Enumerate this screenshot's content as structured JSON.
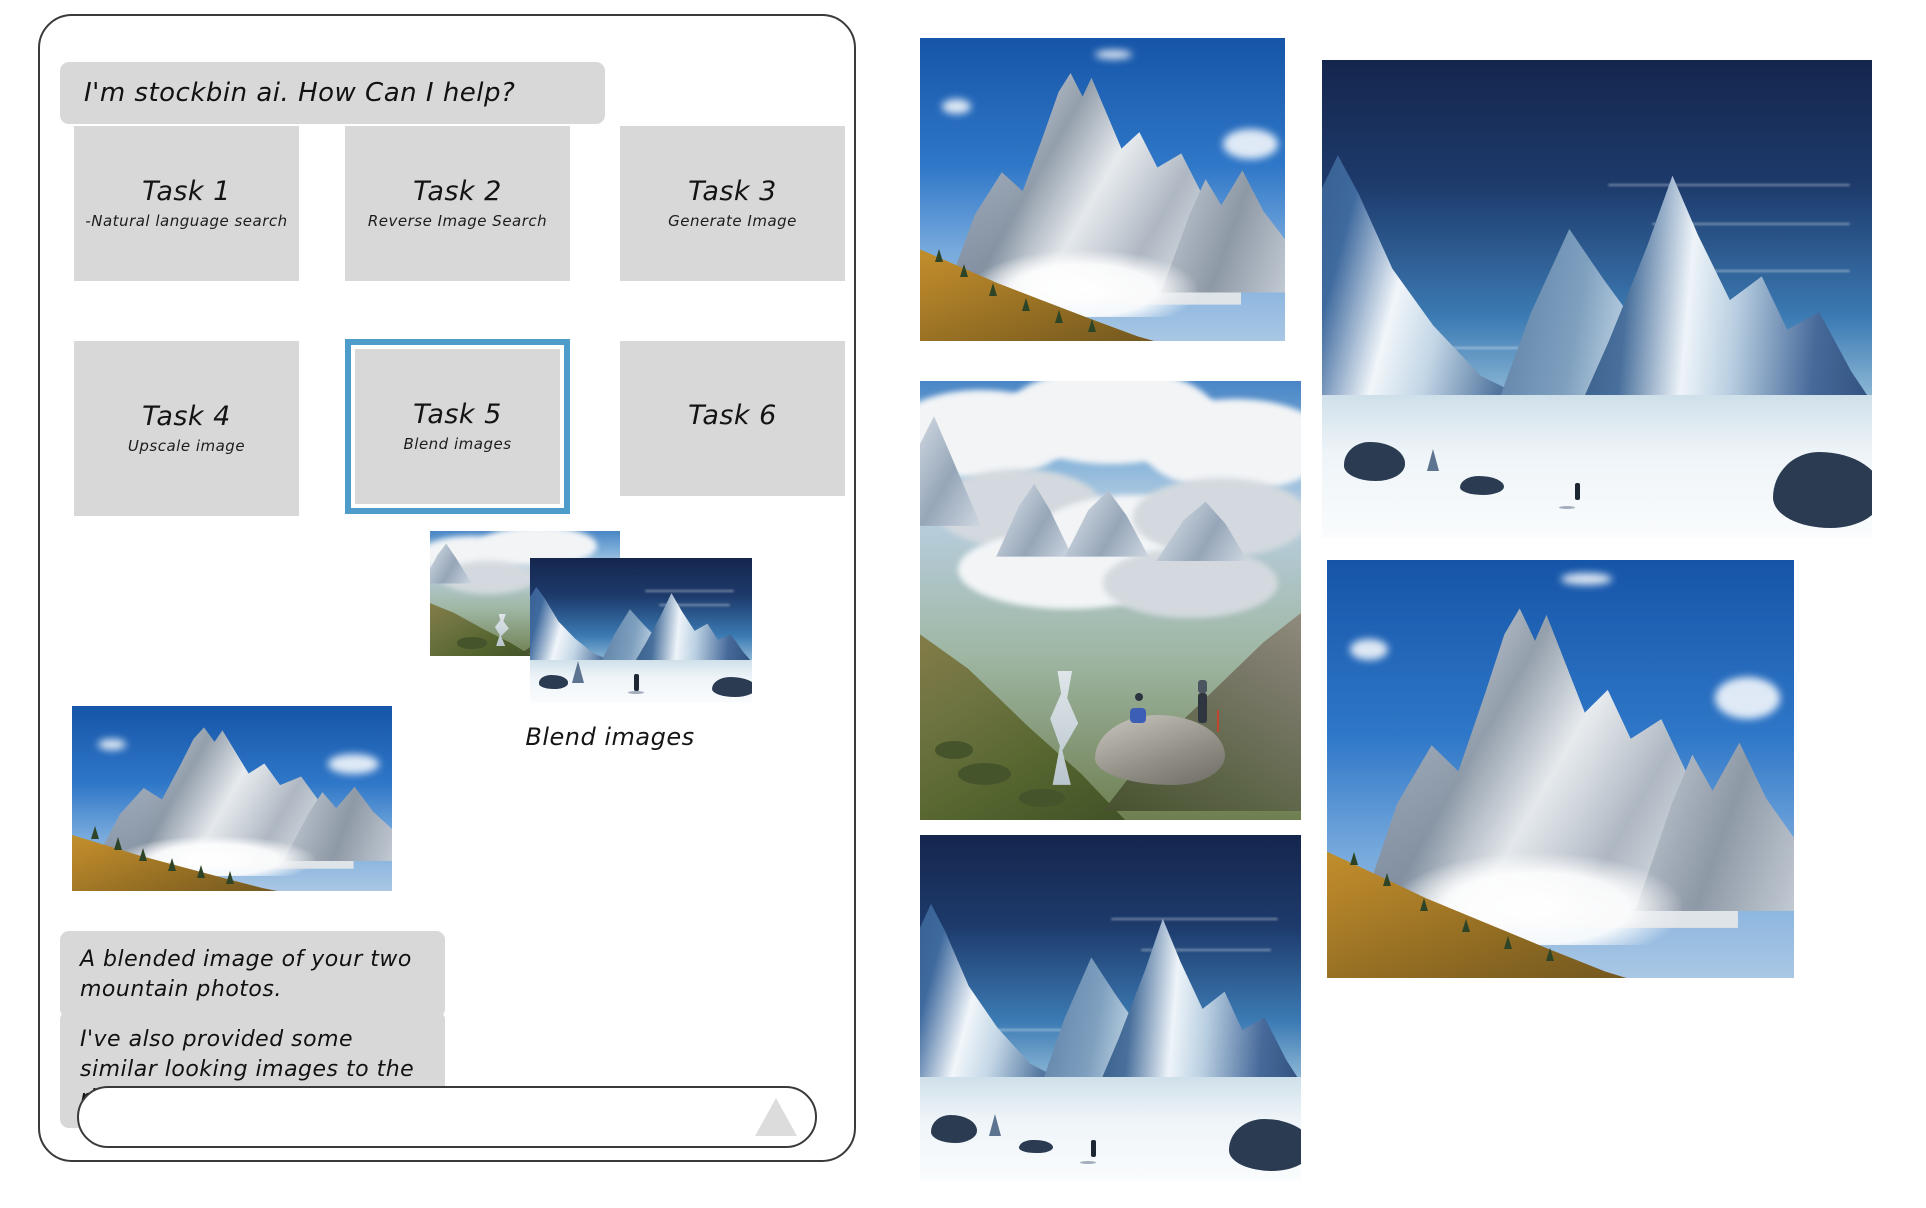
{
  "app": {
    "assistant_name": "stockbin ai"
  },
  "chat": {
    "greeting": "I'm stockbin ai.  How Can I help?",
    "responses": [
      "A blended image of your two mountain photos.",
      "I've also provided some similar looking images to the right."
    ],
    "blend_caption": "Blend images"
  },
  "tasks": [
    {
      "title": "Task 1",
      "subtitle": "-Natural language search",
      "selected": false
    },
    {
      "title": "Task 2",
      "subtitle": "Reverse Image Search",
      "selected": false
    },
    {
      "title": "Task 3",
      "subtitle": "Generate Image",
      "selected": false
    },
    {
      "title": "Task 4",
      "subtitle": "Upscale image",
      "selected": false
    },
    {
      "title": "Task 5",
      "subtitle": "Blend images",
      "selected": true
    },
    {
      "title": "Task 6",
      "subtitle": "",
      "selected": false
    }
  ],
  "composer": {
    "value": "",
    "placeholder": "",
    "send_icon": "send-triangle-icon"
  },
  "gallery": {
    "items": [
      {
        "alt": "Snow-capped Machapuchare peak above a golden ridge",
        "kind": "photo-peak"
      },
      {
        "alt": "Trekkers on a rock above a cloud-filled Himalayan valley",
        "kind": "photo-valley"
      },
      {
        "alt": "Digital art of twin snowy peaks with a lone figure",
        "kind": "art-snow"
      },
      {
        "alt": "Digital art of twin snowy peaks with a lone figure",
        "kind": "art-snow"
      },
      {
        "alt": "Snow-capped Machapuchare peak above a golden ridge",
        "kind": "photo-peak"
      }
    ]
  },
  "preview": {
    "thumb_a_alt": "Mountain photo in clouds",
    "thumb_b_alt": "Digital art snowy peaks",
    "result_alt": "Blended mountain image result"
  },
  "colors": {
    "bubble_gray": "#d8d8d8",
    "card_gray": "#d8d8d8",
    "selection_blue": "#4e9cc9",
    "panel_border": "#3a3a3a",
    "send_gray": "#dcdcdc",
    "text": "#151515"
  }
}
